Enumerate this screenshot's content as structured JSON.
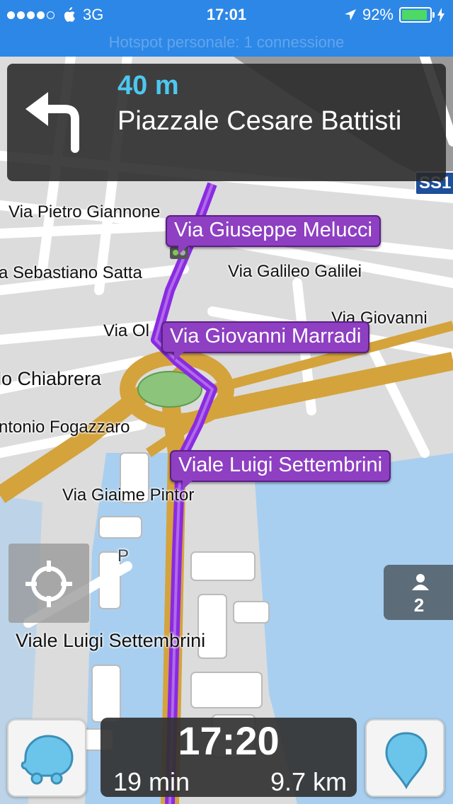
{
  "status_bar": {
    "carrier_network": "3G",
    "time": "17:01",
    "battery_percent": "92%",
    "signal_bars_filled": 4,
    "signal_bars_total": 5
  },
  "hotspot_banner": "Hotspot personale: 1 connessione",
  "instruction": {
    "distance": "40 m",
    "street": "Piazzale Cesare Battisti",
    "turn_direction": "turn-left-icon"
  },
  "route_shield": "SS1",
  "route_tags": [
    "Via Giuseppe Melucci",
    "Via Giovanni Marradi",
    "Viale Luigi Settembrini"
  ],
  "street_labels": {
    "giannone": "Via Pietro Giannone",
    "satta": "a Sebastiano Satta",
    "galilei": "Via Galileo Galilei",
    "giovanni": "Via Giovanni",
    "ol": "Via Ol",
    "chiabrera": "lo Chiabrera",
    "fogazzaro": "ntonio Fogazzaro",
    "pintor": "Via Giaime Pintor",
    "parking": "P",
    "settembrini": "Viale Luigi Settembrini"
  },
  "users_count": "2",
  "eta": {
    "arrival_time": "17:20",
    "duration": "19 min",
    "distance": "9.7 km"
  },
  "colors": {
    "status_bar": "#2d87e6",
    "route": "#8a2be2",
    "road_major": "#d4a33c",
    "distance_text": "#4cc8f0",
    "water": "#a8cff0"
  }
}
